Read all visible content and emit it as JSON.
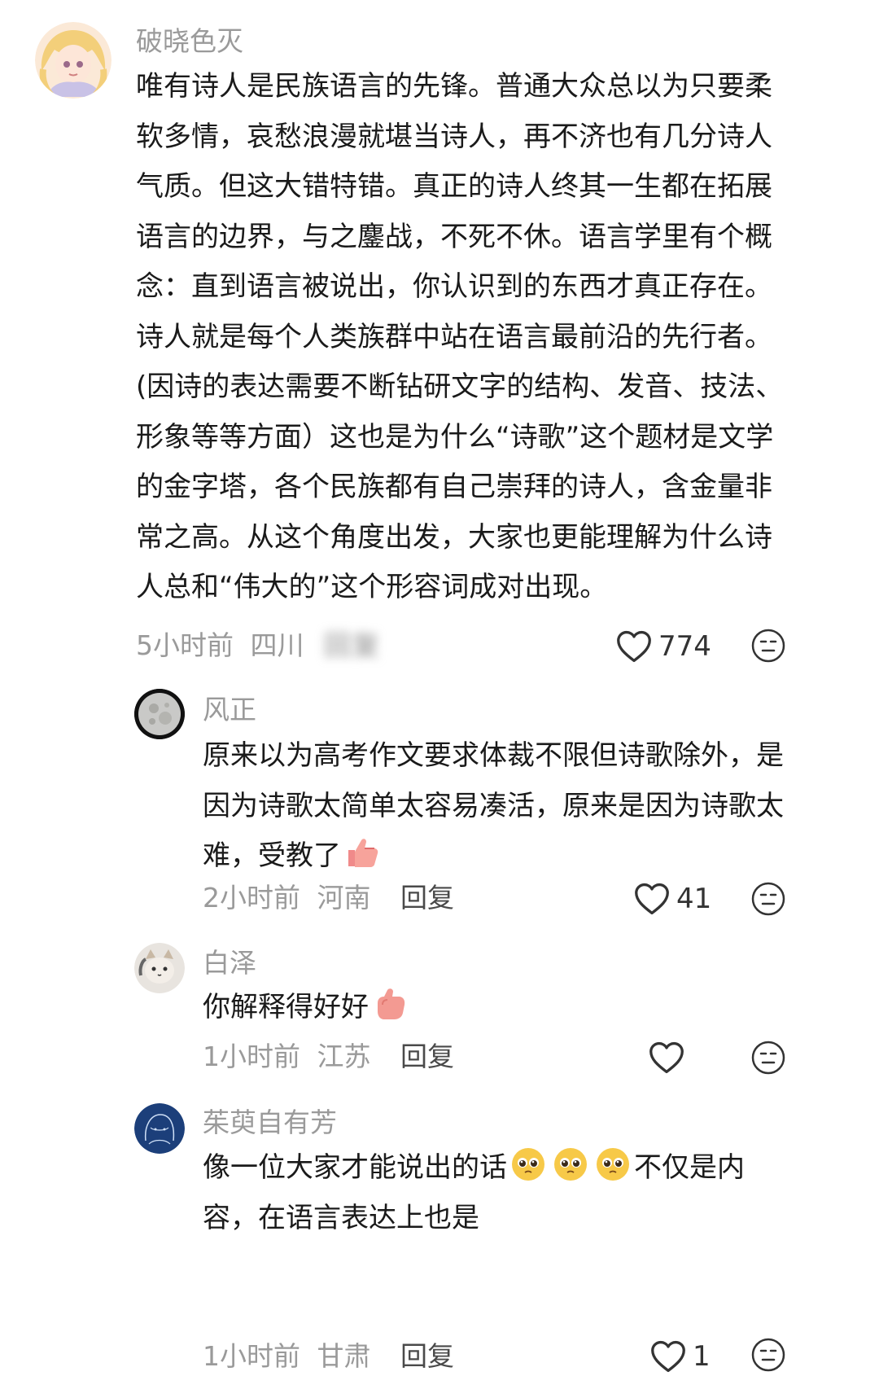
{
  "comments": [
    {
      "username": "破晓色灭",
      "text": "唯有诗人是民族语言的先锋。普通大众总以为只要柔软多情，哀愁浪漫就堪当诗人，再不济也有几分诗人气质。但这大错特错。真正的诗人终其一生都在拓展语言的边界，与之鏖战，不死不休。语言学里有个概念：直到语言被说出，你认识到的东西才真正存在。诗人就是每个人类族群中站在语言最前沿的先行者。(因诗的表达需要不断钻研文字的结构、发音、技法、形象等等方面）这也是为什么“诗歌”这个题材是文学的金字塔，各个民族都有自己崇拜的诗人，含金量非常之高。从这个角度出发，大家也更能理解为什么诗人总和“伟大的”这个形容词成对出现。",
      "time": "5小时前",
      "location": "四川",
      "blurred_reply": "回复",
      "likes": "774"
    },
    {
      "username": "风正",
      "text_before_emoji": "原来以为高考作文要求体裁不限但诗歌除外，是因为诗歌太简单太容易凑活，原来是因为诗歌太难，受教了",
      "emoji": "thumbs-up-emoji",
      "time": "2小时前",
      "location": "河南",
      "reply": "回复",
      "likes": "41"
    },
    {
      "username": "白泽",
      "text_before_emoji": "你解释得好好",
      "emoji": "thumbs-up-emoji",
      "time": "1小时前",
      "location": "江苏",
      "reply": "回复",
      "likes": ""
    },
    {
      "username": "茱萸自有芳",
      "text_before_emoji": "像一位大家才能说出的话",
      "emoji": "pleading-face-emoji",
      "text_after_emoji": "不仅是内容，在语言表达上也是",
      "time": "1小时前",
      "location": "甘肃",
      "reply": "回复",
      "likes": "1"
    }
  ],
  "colors": {
    "text": "#1a1a1a",
    "muted": "#9a9a9a",
    "background": "#ffffff"
  }
}
